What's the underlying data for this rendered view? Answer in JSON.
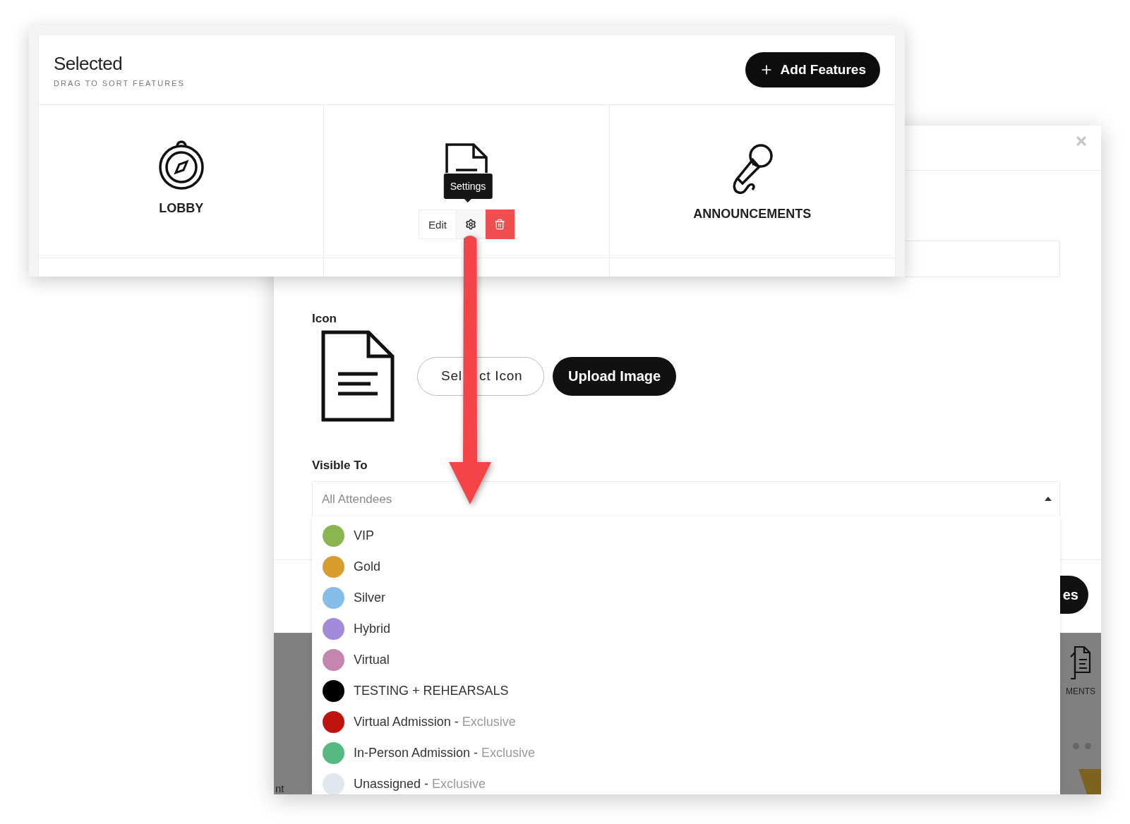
{
  "features_panel": {
    "title": "Selected",
    "subtitle": "DRAG TO SORT FEATURES",
    "add_button": "Add Features",
    "features": [
      {
        "kind": "compass",
        "label": "LOBBY",
        "hovered": false
      },
      {
        "kind": "document",
        "hovered": true,
        "tooltip": "Settings",
        "edit_button": "Edit"
      },
      {
        "kind": "microphone",
        "label": "ANNOUNCEMENTS",
        "hovered": false
      }
    ]
  },
  "settings_modal": {
    "icon_label": "Icon",
    "select_icon_button": {
      "text_before_arrow": "Sel",
      "text_after_arrow": "ct Icon"
    },
    "upload_button": "Upload Image",
    "visible_to_label": "Visible To",
    "visible_to": {
      "placeholder": "All Attendees",
      "expanded": true
    },
    "options": [
      {
        "name": "VIP",
        "color": "#8bb54f"
      },
      {
        "name": "Gold",
        "color": "#d89d2e"
      },
      {
        "name": "Silver",
        "color": "#84bde8"
      },
      {
        "name": "Hybrid",
        "color": "#a38bd9"
      },
      {
        "name": "Virtual",
        "color": "#c485b0"
      },
      {
        "name": "TESTING + REHEARSALS",
        "color": "#000000"
      },
      {
        "name": "Virtual Admission -",
        "note": "Exclusive",
        "color": "#bf130f"
      },
      {
        "name": "In-Person Admission -",
        "note": "Exclusive",
        "color": "#55b980"
      },
      {
        "name": "Unassigned -",
        "note": "Exclusive",
        "color": "#e0e7ee"
      }
    ],
    "footer_button": "es",
    "background_page": {
      "feature_label": "MENTS",
      "text_fragment": "nt"
    }
  }
}
